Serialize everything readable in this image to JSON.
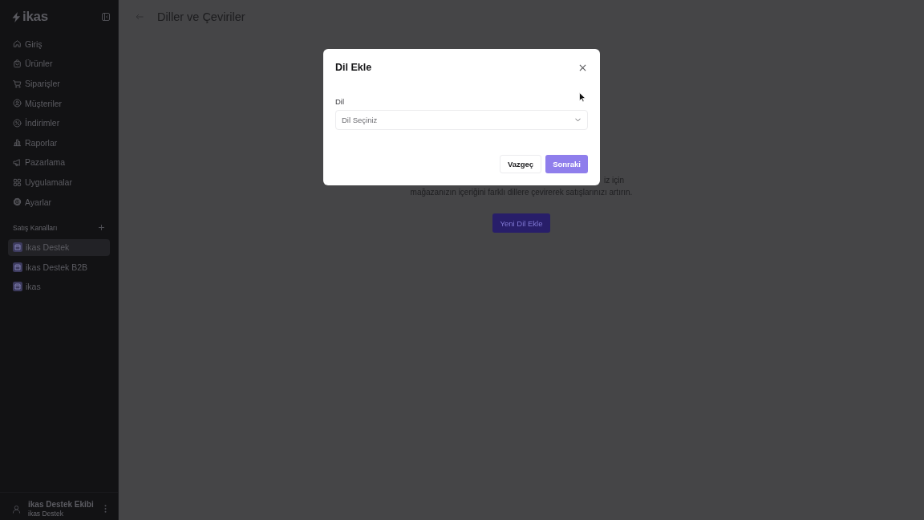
{
  "sidebar": {
    "logo": "ikas",
    "nav": [
      {
        "kind": "home",
        "label": "Giriş"
      },
      {
        "kind": "bag",
        "label": "Ürünler"
      },
      {
        "kind": "cart",
        "label": "Siparişler"
      },
      {
        "kind": "customer",
        "label": "Müşteriler"
      },
      {
        "kind": "discount",
        "label": "İndirimler"
      },
      {
        "kind": "report",
        "label": "Raporlar"
      },
      {
        "kind": "megaphone",
        "label": "Pazarlama"
      },
      {
        "kind": "apps",
        "label": "Uygulamalar"
      },
      {
        "kind": "settings",
        "label": "Ayarlar"
      }
    ],
    "channels_title": "Satış Kanalları",
    "channels": [
      {
        "label": "ikas Destek",
        "selected": true
      },
      {
        "label": "ikas Destek B2B",
        "selected": false
      },
      {
        "label": "ikas",
        "selected": false
      }
    ],
    "user": {
      "name": "ikas Destek Ekibi",
      "subtitle": "ikas Destek"
    }
  },
  "page": {
    "title": "Diller ve Çeviriler",
    "description": [
      "iz için",
      "mağazanızın içeriğini farklı dillere çevirerek satışlarınızı artırın."
    ],
    "button": "Yeni Dil Ekle"
  },
  "dialog": {
    "title": "Dil Ekle",
    "field": {
      "label": "Dil",
      "placeholder": "Dil Seçiniz"
    },
    "buttons": [
      {
        "kind": "secondary",
        "label": "Vazgeç",
        "disabled": false
      },
      {
        "kind": "primary",
        "label": "Sonraki",
        "disabled": true
      }
    ]
  }
}
